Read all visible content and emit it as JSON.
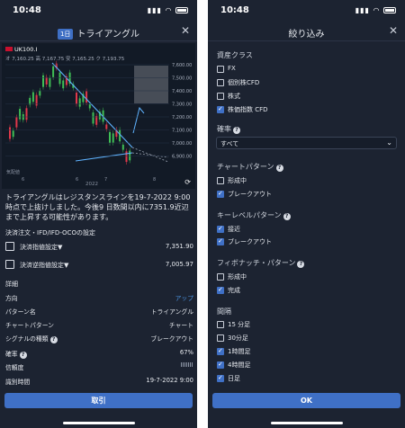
{
  "left": {
    "status_time": "10:48",
    "badge": "1日",
    "title": "トライアングル",
    "chart": {
      "symbol": "UK100.I",
      "ohlc": "オ 7,160.25  高 7,167.75  安 7,165.25  ク 7,193.75",
      "foot": "気配値",
      "year": "2022",
      "y_ticks": [
        "7,600.00",
        "7,500.00",
        "7,400.00",
        "7,300.00",
        "7,200.00",
        "7,100.00",
        "7,000.00",
        "6,900.00"
      ],
      "x_ticks": [
        "6",
        "6",
        "7",
        "8"
      ]
    },
    "description": "トライアングルはレジスタンスラインを19-7-2022 9:00時点で上抜けしました。今後9 日数間以内に7351.9近辺まで上昇する可能性があります。",
    "order_section": "決済注文・IFD/IFD-OCOの設定",
    "orders": [
      {
        "label": "決済指値設定▼",
        "value": "7,351.90"
      },
      {
        "label": "決済逆指値設定▼",
        "value": "7,005.97"
      }
    ],
    "details_title": "詳細",
    "details": [
      {
        "key": "方向",
        "value": "アップ"
      },
      {
        "key": "パターン名",
        "value": "トライアングル"
      },
      {
        "key": "チャートパターン",
        "value": "チャート"
      },
      {
        "key": "シグナルの種類",
        "value": "ブレークアウト"
      },
      {
        "key": "確率",
        "value": "67%"
      },
      {
        "key": "信頼度",
        "value": ""
      },
      {
        "key": "識別時間",
        "value": "19-7-2022 9:00"
      }
    ],
    "button": "取引"
  },
  "right": {
    "status_time": "10:48",
    "title": "絞り込み",
    "asset_class": "資産クラス",
    "assets": [
      {
        "label": "FX",
        "checked": false
      },
      {
        "label": "個別株CFD",
        "checked": false
      },
      {
        "label": "株式",
        "checked": false
      },
      {
        "label": "株価指数 CFD",
        "checked": true
      }
    ],
    "probability": "確率",
    "probability_value": "すべて",
    "chart_pattern": "チャートパターン",
    "chart_patterns": [
      {
        "label": "形成中",
        "checked": false
      },
      {
        "label": "ブレークアウト",
        "checked": true
      }
    ],
    "key_level": "キーレベルパターン",
    "key_levels": [
      {
        "label": "接近",
        "checked": true
      },
      {
        "label": "ブレークアウト",
        "checked": true
      }
    ],
    "fibonacci": "フィボナッチ・パターン",
    "fibonaccis": [
      {
        "label": "形成中",
        "checked": false
      },
      {
        "label": "完成",
        "checked": true
      }
    ],
    "interval": "間隔",
    "intervals": [
      {
        "label": "15 分足",
        "checked": false
      },
      {
        "label": "30分足",
        "checked": false
      },
      {
        "label": "1時間足",
        "checked": true
      },
      {
        "label": "4時間足",
        "checked": true
      },
      {
        "label": "日足",
        "checked": true
      }
    ],
    "button": "OK"
  }
}
